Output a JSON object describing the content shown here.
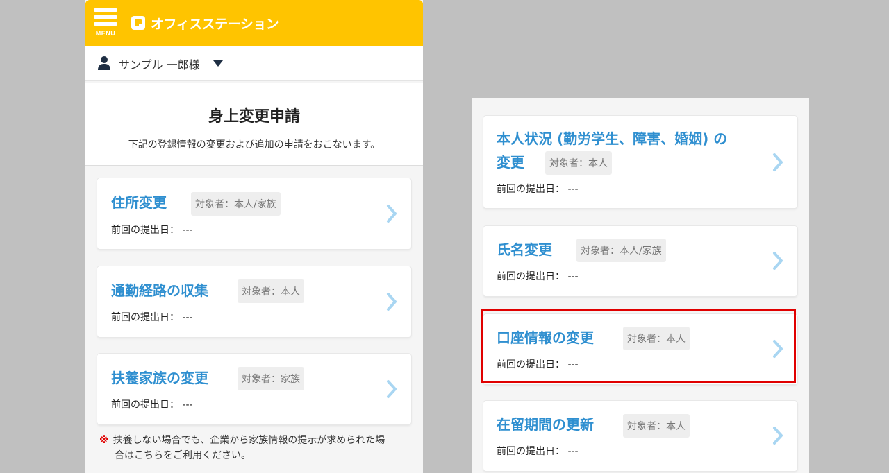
{
  "header": {
    "menu_label": "MENU",
    "brand": "オフィスステーション",
    "bg_color": "#ffc400"
  },
  "user": {
    "name": "サンプル 一郎様",
    "icon": "user-icon"
  },
  "page": {
    "title": "身上変更申請",
    "description": "下記の登録情報の変更および追加の申請をおこないます。"
  },
  "left_cards": [
    {
      "title": "住所変更",
      "target": "対象者：本人/家族",
      "last_label": "前回の提出日：",
      "last_value": "---"
    },
    {
      "title": "通勤経路の収集",
      "target": "対象者：本人",
      "last_label": "前回の提出日：",
      "last_value": "---"
    },
    {
      "title": "扶養家族の変更",
      "target": "対象者：家族",
      "last_label": "前回の提出日：",
      "last_value": "---"
    }
  ],
  "note": {
    "mark": "※",
    "line1": "扶養しない場合でも、企業から家族情報の提示が求められた場",
    "line2": "合はこちらをご利用ください。"
  },
  "right_cards": [
    {
      "title_line1": "本人状況 (勤労学生、障害、婚姻) の",
      "title_line2": "変更",
      "target": "対象者：本人",
      "last_label": "前回の提出日：",
      "last_value": "---"
    },
    {
      "title": "氏名変更",
      "target": "対象者：本人/家族",
      "last_label": "前回の提出日：",
      "last_value": "---"
    },
    {
      "title": "口座情報の変更",
      "target": "対象者：本人",
      "last_label": "前回の提出日：",
      "last_value": "---",
      "highlighted": true
    },
    {
      "title": "在留期間の更新",
      "target": "対象者：本人",
      "last_label": "前回の提出日：",
      "last_value": "---"
    }
  ],
  "colors": {
    "accent_title": "#2f8fd0",
    "chevron": "#a9d6f2",
    "highlight": "#e00000"
  }
}
